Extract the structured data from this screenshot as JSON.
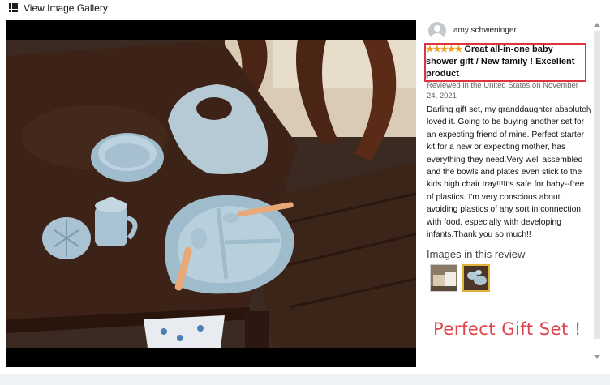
{
  "header": {
    "title": "View Image Gallery",
    "icon": "grid-icon"
  },
  "review": {
    "reviewer": "amy schweninger",
    "rating": 5,
    "stars": "★★★★★",
    "headline": "Great all-in-one baby shower gift / New family ! Excellent product",
    "meta": "Reviewed in the United States on November 24, 2021",
    "body": "Darling gift set, my granddaughter absolutely loved it. Going to be buying another set for an expecting friend of mine. Perfect starter kit for a new or expecting mother, has everything they need.Very well assembled and the bowls and plates even stick to the kids high chair tray!!!It's safe for baby--free of plastics. I'm very conscious about avoiding plastics of any sort in connection with food, especially with developing infants.Thank you so much!!",
    "images_label": "Images in this review",
    "thumbnails": [
      "thumbnail-1",
      "thumbnail-2"
    ]
  },
  "overlay_text": "Perfect Gift Set !",
  "colors": {
    "star": "#f29b18",
    "highlight_border": "#d9363e",
    "overlay_text": "#e0434b",
    "silicone": "#a9c3d3"
  }
}
